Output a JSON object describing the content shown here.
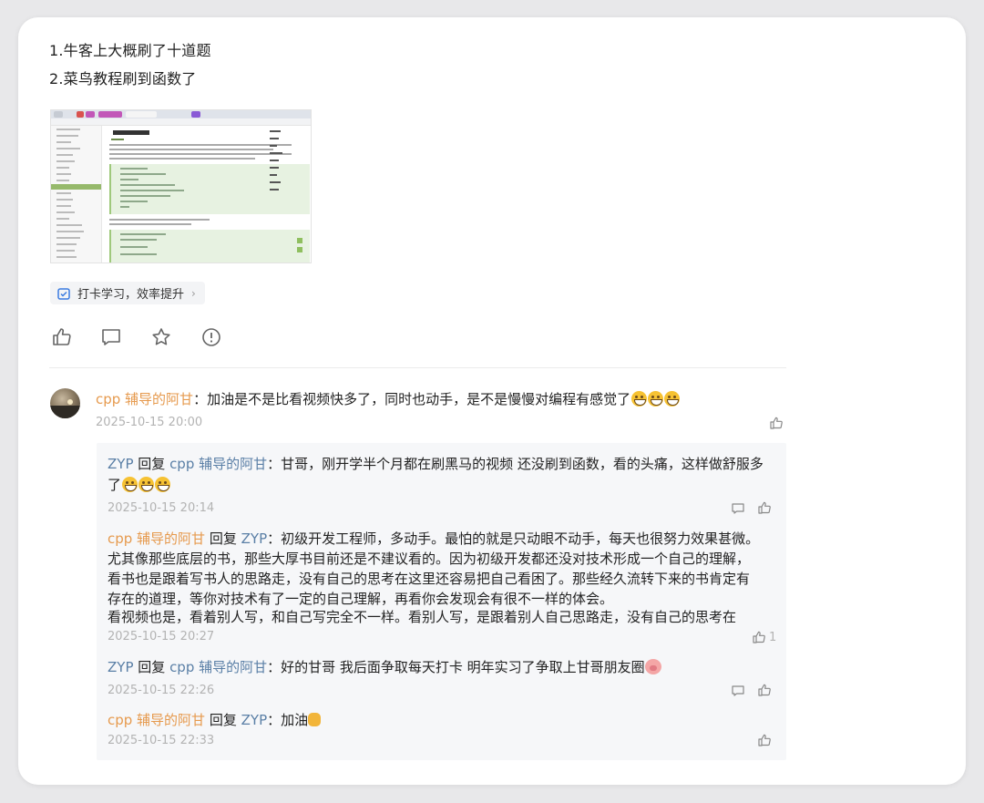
{
  "post": {
    "line1": "1.牛客上大概刷了十道题",
    "line2": "2.菜鸟教程刷到函数了",
    "tag_label": "打卡学习，效率提升"
  },
  "actions": [
    "like-icon",
    "comment-icon",
    "star-icon",
    "report-icon"
  ],
  "comments": {
    "top": {
      "author": "cpp 辅导的阿甘",
      "text": "：加油是不是比看视频快多了，同时也动手，是不是慢慢对编程有感觉了",
      "time": "2025-10-15 20:00"
    },
    "replies": [
      {
        "author": "ZYP",
        "reply_word": "回复",
        "target": "cpp 辅导的阿甘",
        "text_line1": "：甘哥，刚开学半个月都在刷黑马的视频 还没刷到函数，看的头痛，这样做舒服多",
        "text_line2": "了",
        "time": "2025-10-15 20:14"
      },
      {
        "author": "cpp 辅导的阿甘",
        "reply_word": "回复",
        "target": "ZYP",
        "text_line1": "：初级开发工程师，多动手。最怕的就是只动眼不动手，每天也很努力效果甚微。",
        "text_line2": "尤其像那些底层的书，那些大厚书目前还是不建议看的。因为初级开发都还没对技术形成一个自己的理解，",
        "text_line3": "看书也是跟着写书人的思路走，没有自己的思考在这里还容易把自己看困了。那些经久流转下来的书肯定有",
        "text_line4": "存在的道理，等你对技术有了一定的自己理解，再看你会发现会有很不一样的体会。",
        "text_line5": "看视频也是，看着别人写，和自己写完全不一样。看别人写，是跟着别人自己思路走，没有自己的思考在",
        "time": "2025-10-15 20:27",
        "likes": "1"
      },
      {
        "author": "ZYP",
        "reply_word": "回复",
        "target": "cpp 辅导的阿甘",
        "text": "：好的甘哥 我后面争取每天打卡 明年实习了争取上甘哥朋友圈",
        "time": "2025-10-15 22:26"
      },
      {
        "author": "cpp 辅导的阿甘",
        "reply_word": "回复",
        "target": "ZYP",
        "text": "：加油",
        "time": "2025-10-15 22:33"
      }
    ]
  },
  "thumbnail": {
    "page_heading": "C++ 指针调用"
  },
  "colors": {
    "username": "#e69a4e",
    "reply_target": "#5a7fa6",
    "timestamp": "#b3b3b3",
    "reply_bg": "#f6f7f9"
  }
}
